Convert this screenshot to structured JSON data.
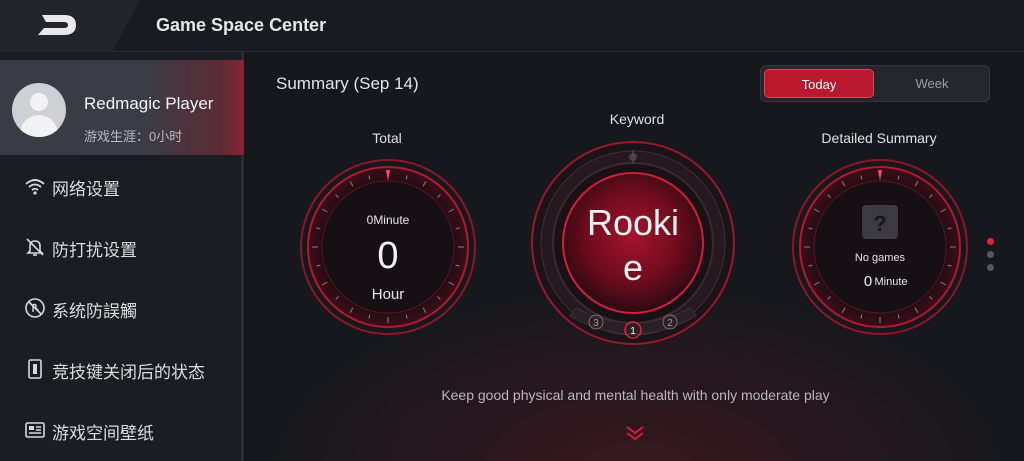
{
  "header": {
    "title": "Game Space Center",
    "logo_icon": "redmagic-logo-icon"
  },
  "profile": {
    "name": "Redmagic Player",
    "subtitle": "游戏生涯：0小时"
  },
  "sidebar": {
    "items": [
      {
        "label": "网络设置",
        "icon": "wifi-icon"
      },
      {
        "label": "防打扰设置",
        "icon": "bell-off-icon"
      },
      {
        "label": "系统防誤觸",
        "icon": "touch-block-icon"
      },
      {
        "label": "竞技键关闭后的状态",
        "icon": "switch-icon"
      },
      {
        "label": "游戏空间壁纸",
        "icon": "wallpaper-icon"
      }
    ]
  },
  "summary": {
    "title": "Summary (Sep 14)",
    "toggle": {
      "today": "Today",
      "week": "Week",
      "selected": "Today"
    }
  },
  "total": {
    "label": "Total",
    "minutes_text": "0Minute",
    "value": "0",
    "unit": "Hour"
  },
  "keyword": {
    "label": "Keyword",
    "line1": "Rooki",
    "line2": "e",
    "pages": [
      "3",
      "1",
      "2"
    ],
    "active_page": "1"
  },
  "detailed": {
    "label": "Detailed Summary",
    "games_text": "No games",
    "minute_value": "0",
    "minute_unit": "Minute"
  },
  "footer": {
    "message": "Keep good physical and mental health with only moderate play"
  },
  "colors": {
    "accent": "#b8192e",
    "accent_bright": "#e0243e",
    "background": "#17181d"
  }
}
